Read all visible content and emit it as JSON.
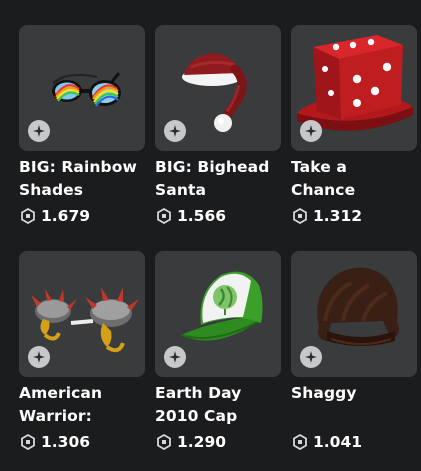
{
  "items": [
    {
      "name_line1": "BIG: Rainbow",
      "name_line2": "Shades",
      "price": "1.679",
      "icon": "rainbow-shades-icon"
    },
    {
      "name_line1": "BIG: Bighead",
      "name_line2": "Santa",
      "price": "1.566",
      "icon": "santa-hat-icon"
    },
    {
      "name_line1": "Take a",
      "name_line2": "Chance",
      "price": "1.312",
      "icon": "dice-hat-icon"
    },
    {
      "name_line1": "American",
      "name_line2": "Warrior:",
      "price": "1.306",
      "icon": "spiked-helmet-icon"
    },
    {
      "name_line1": "Earth Day",
      "name_line2": "2010 Cap",
      "price": "1.290",
      "icon": "earth-day-cap-icon"
    },
    {
      "name_line1": "Shaggy",
      "name_line2": "",
      "price": "1.041",
      "icon": "shaggy-hair-icon"
    }
  ],
  "colors": {
    "background": "#1b1c1e",
    "card": "#393b3d",
    "text": "#ffffff"
  }
}
